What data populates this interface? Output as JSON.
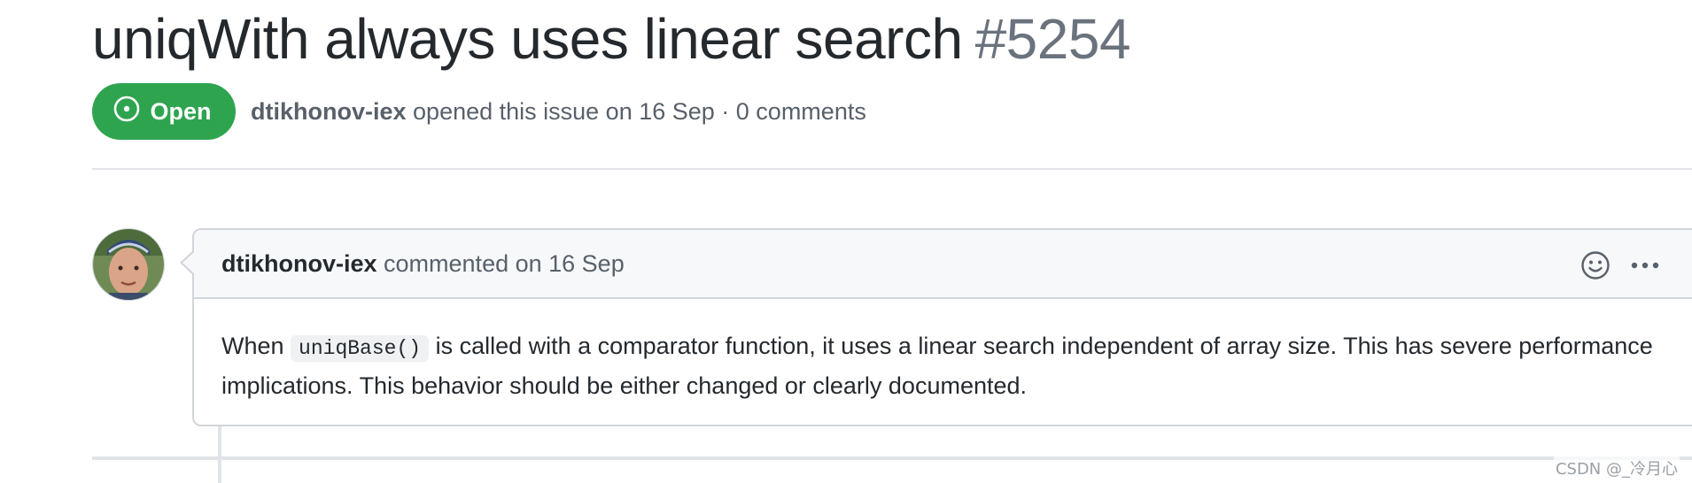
{
  "issue": {
    "title": "uniqWith always uses linear search",
    "number": "#5254",
    "state": "Open",
    "author": "dtikhonov-iex",
    "meta_text": "opened this issue on 16 Sep · 0 comments"
  },
  "comment": {
    "author": "dtikhonov-iex",
    "action_text": "commented on 16 Sep",
    "body_before_code": "When ",
    "code": "uniqBase()",
    "body_after_code": " is called with a comparator function, it uses a linear search independent of array size. This has severe performance implications. This behavior should be either changed or clearly documented."
  },
  "icons": {
    "state": "issue-opened-icon",
    "reaction": "smiley-icon",
    "more": "kebab-horizontal-icon"
  },
  "colors": {
    "open_badge": "#2ea44f",
    "text": "#24292e",
    "muted": "#586069",
    "border": "#d1d5da"
  },
  "watermark": "CSDN @_冷月心"
}
